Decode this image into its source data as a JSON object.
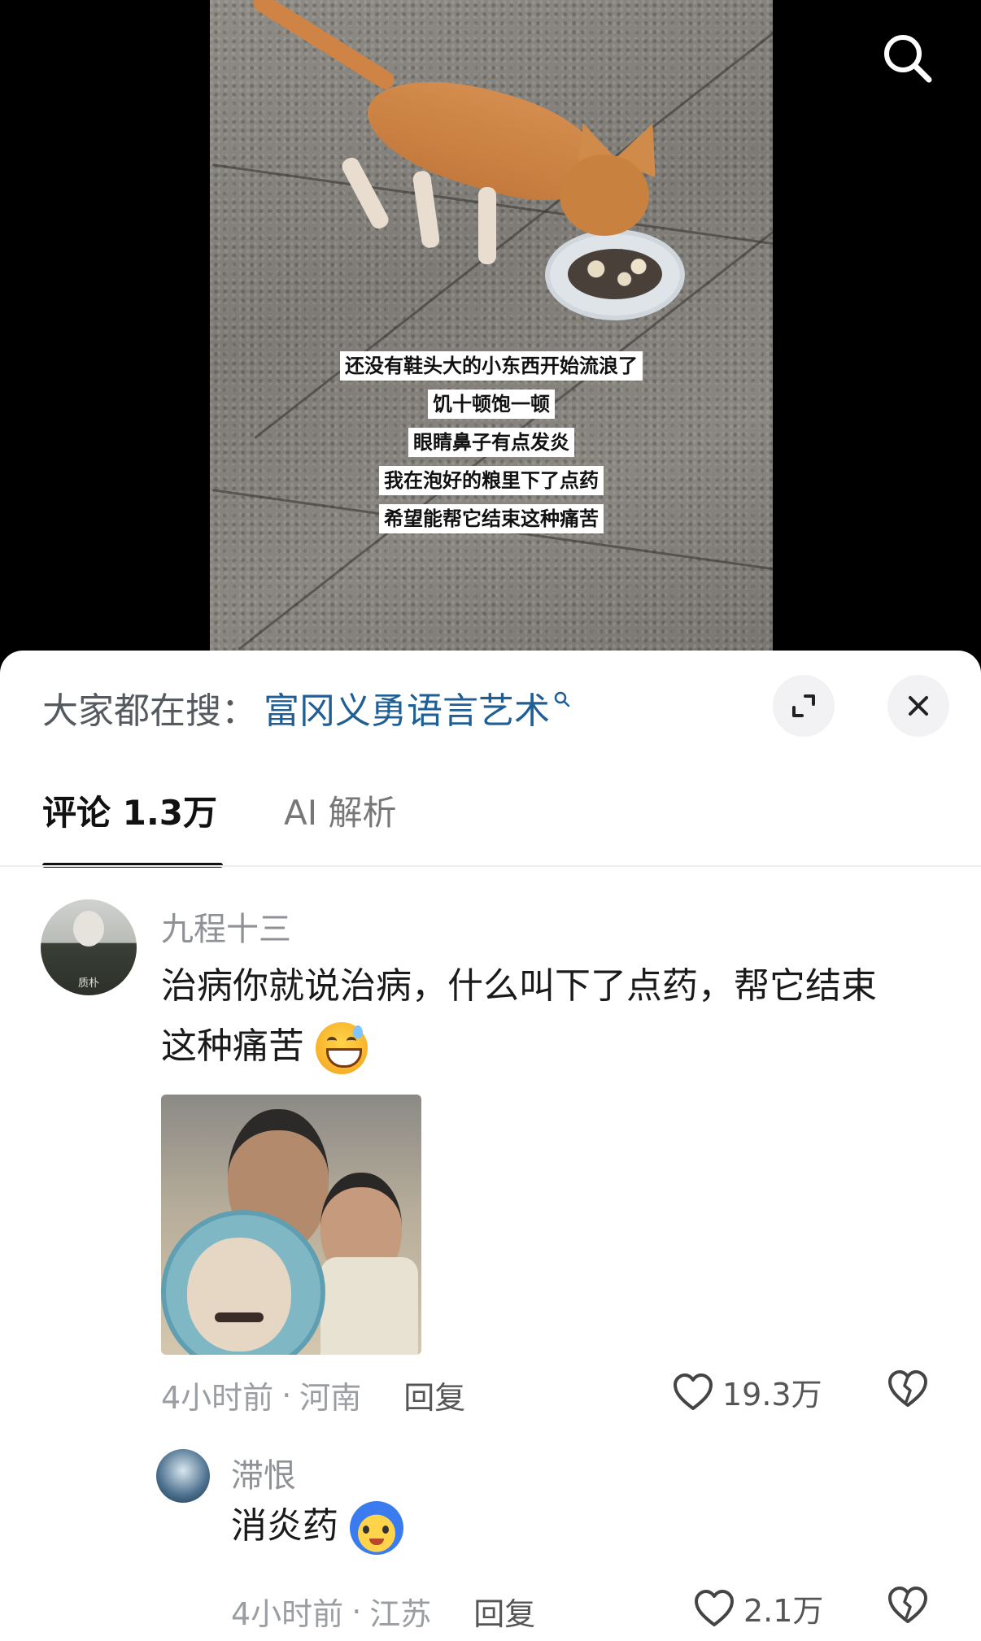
{
  "video": {
    "captions": [
      "还没有鞋头大的小东西开始流浪了",
      "饥十顿饱一顿",
      "眼睛鼻子有点发炎",
      "我在泡好的粮里下了点药",
      "希望能帮它结束这种痛苦"
    ],
    "search_icon": "search-icon"
  },
  "hot_search": {
    "prefix": "大家都在搜：",
    "term": "富冈义勇语言艺术",
    "term_icon": "small-search-icon",
    "term_color": "#1f5f95"
  },
  "header_actions": {
    "expand_icon": "expand-icon",
    "close_icon": "close-icon"
  },
  "tabs": [
    {
      "label": "评论 1.3万",
      "active": true
    },
    {
      "label": "AI 解析",
      "active": false
    }
  ],
  "comments": [
    {
      "username": "九程十三",
      "avatar_caption": "质朴",
      "text_line1": "治病你就说治病，什么叫下了点药，帮它结束",
      "text_line2": "这种痛苦",
      "emoji": "grinning-sweat-emoji",
      "time": "4小时前",
      "location": "河南",
      "reply_label": "回复",
      "likes": "19.3万",
      "has_image": true
    },
    {
      "username": "滞恨",
      "text": "消炎药",
      "emoji": "face-with-blue-hair-emoji",
      "time": "4小时前",
      "location": "江苏",
      "reply_label": "回复",
      "likes": "2.1万"
    }
  ],
  "separator": "·"
}
